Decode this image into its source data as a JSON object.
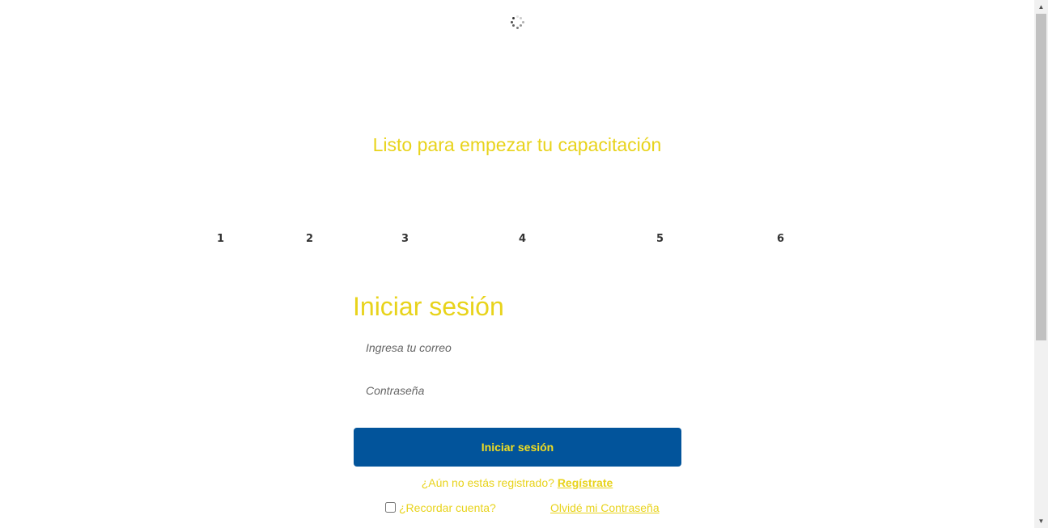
{
  "header": {
    "subtitle": "Listo para empezar tu capacitación"
  },
  "steps": [
    "1",
    "2",
    "3",
    "4",
    "5",
    "6"
  ],
  "login": {
    "title": "Iniciar sesión",
    "email_placeholder": "Ingresa tu correo",
    "password_placeholder": "Contraseña",
    "submit_label": "Iniciar sesión",
    "register_prompt": "¿Aún no estás registrado?",
    "register_link": "Regístrate",
    "remember_label": "¿Recordar cuenta?",
    "forgot_link": "Olvidé mi Contraseña"
  },
  "colors": {
    "accent_yellow": "#e8d31b",
    "button_blue": "#02549b"
  },
  "icons": {
    "spinner": "loading-spinner-icon",
    "scroll_up": "arrow-up-icon",
    "scroll_down": "arrow-down-icon"
  }
}
